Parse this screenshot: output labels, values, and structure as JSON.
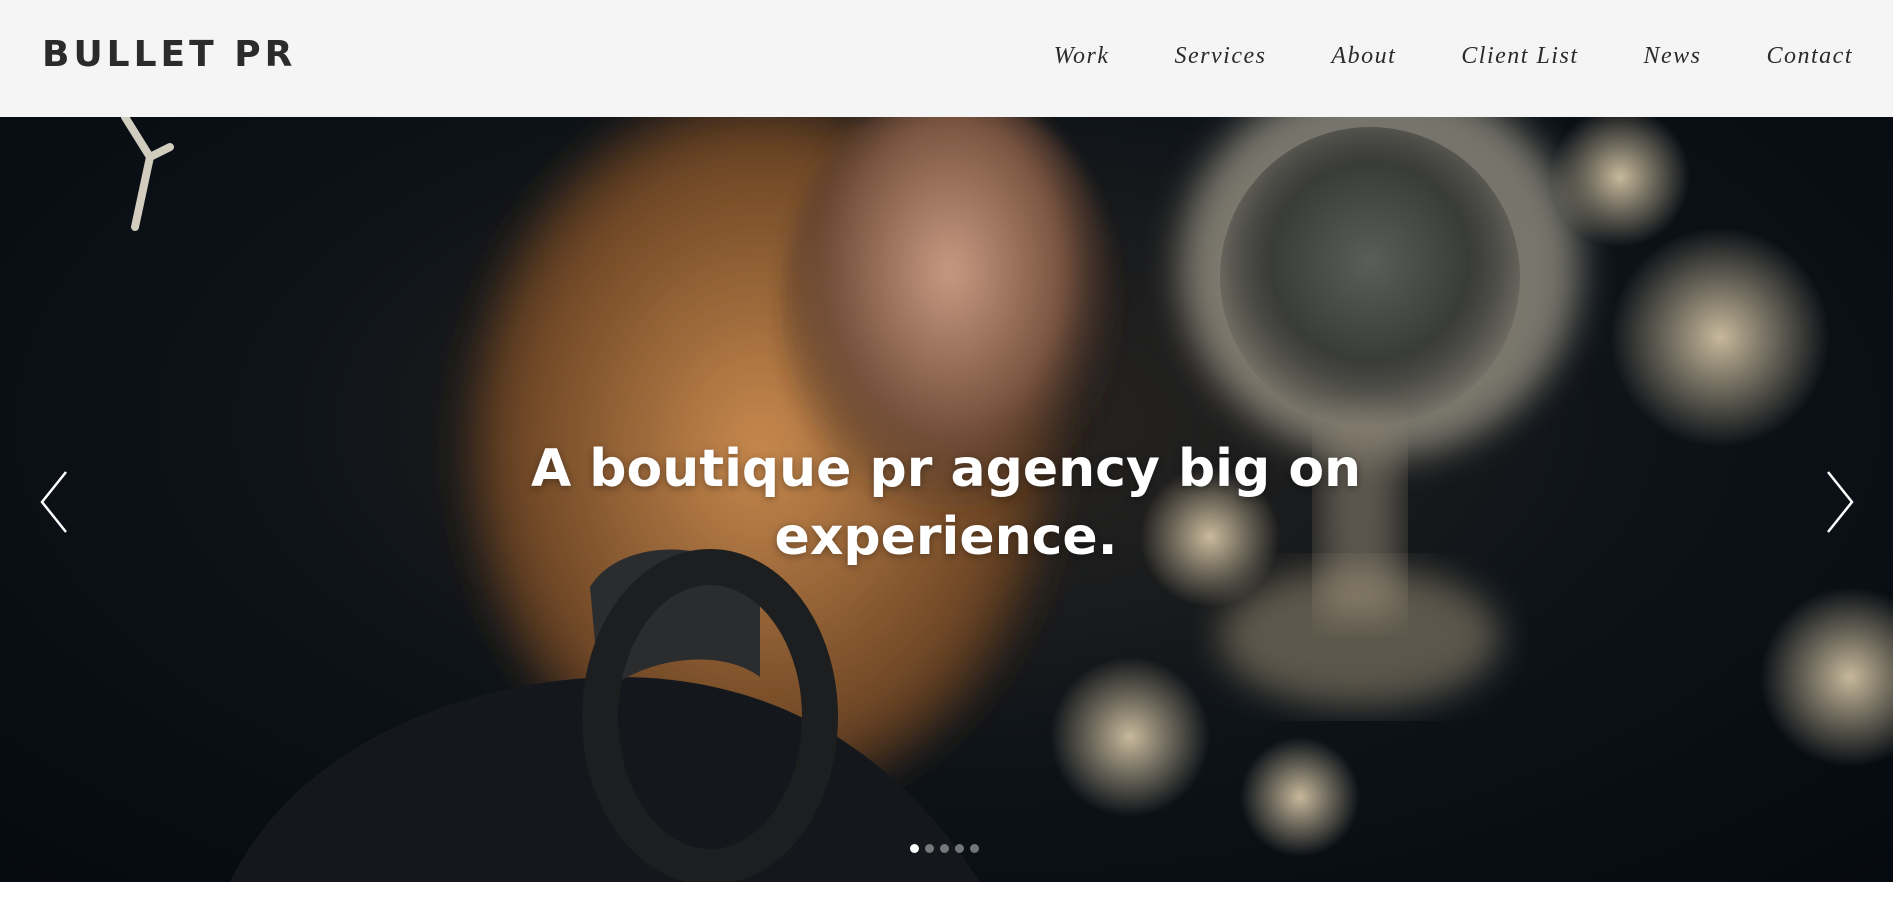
{
  "brand": {
    "logo_text": "BULLET PR"
  },
  "nav": {
    "items": [
      {
        "label": "Work"
      },
      {
        "label": "Services"
      },
      {
        "label": "About"
      },
      {
        "label": "Client List"
      },
      {
        "label": "News"
      },
      {
        "label": "Contact"
      }
    ]
  },
  "hero": {
    "headline_line1": "A boutique pr agency big on",
    "headline_line2": "experience.",
    "slides_total": 5,
    "active_slide": 1
  },
  "colors": {
    "header_bg": "#f5f5f5",
    "text_dark": "#2b2b2b",
    "hero_text": "#ffffff"
  },
  "icons": {
    "prev": "chevron-left-icon",
    "next": "chevron-right-icon"
  }
}
